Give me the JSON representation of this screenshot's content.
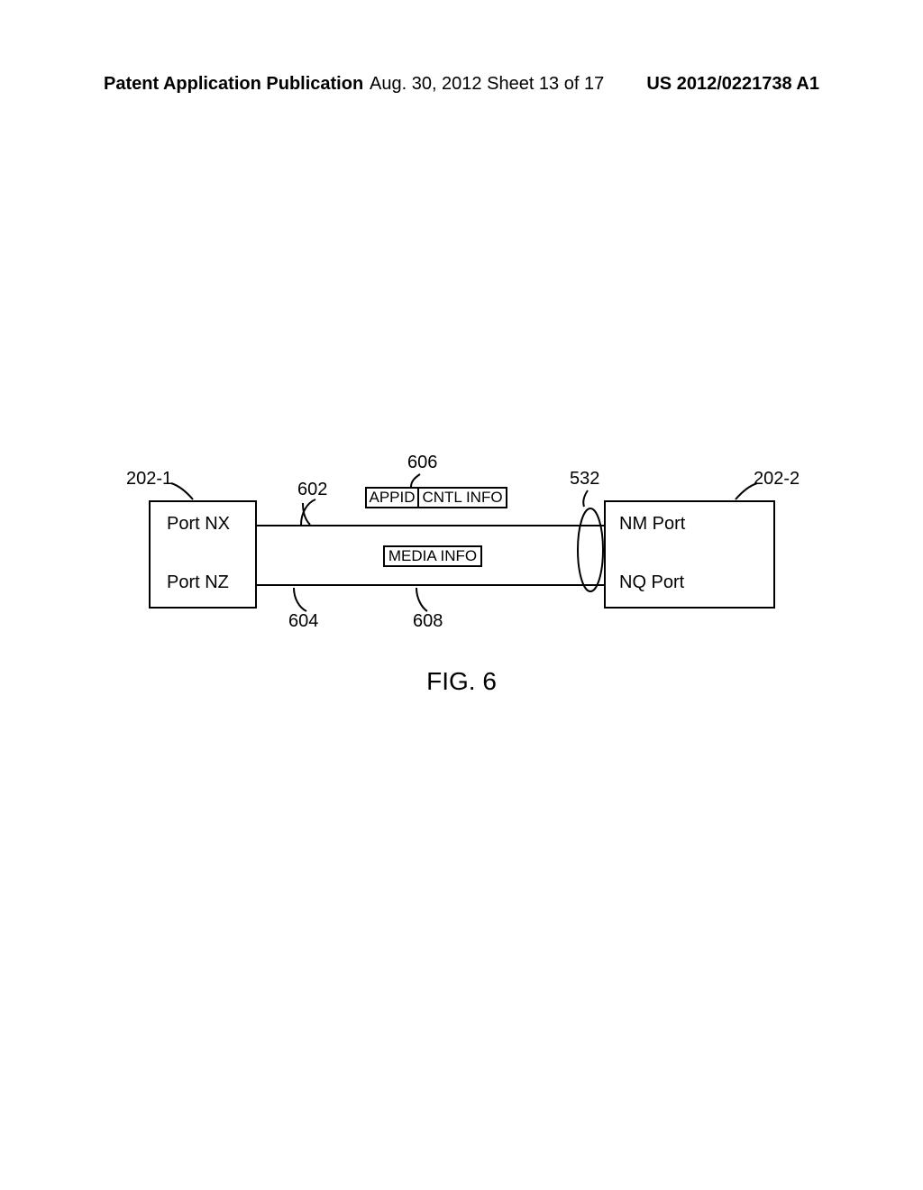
{
  "header": {
    "left": "Patent Application Publication",
    "center": "Aug. 30, 2012  Sheet 13 of 17",
    "right": "US 2012/0221738 A1"
  },
  "diagram": {
    "left_box": {
      "port_top": "Port NX",
      "port_bottom": "Port NZ"
    },
    "right_box": {
      "port_top": "NM Port",
      "port_bottom": "NQ Port"
    },
    "packet_top": {
      "cell1": "APPID",
      "cell2": "CNTL INFO"
    },
    "packet_bottom": "MEDIA INFO",
    "refs": {
      "r202_1": "202-1",
      "r202_2": "202-2",
      "r602": "602",
      "r604": "604",
      "r606": "606",
      "r608": "608",
      "r532": "532"
    },
    "figure_label": "FIG. 6"
  }
}
